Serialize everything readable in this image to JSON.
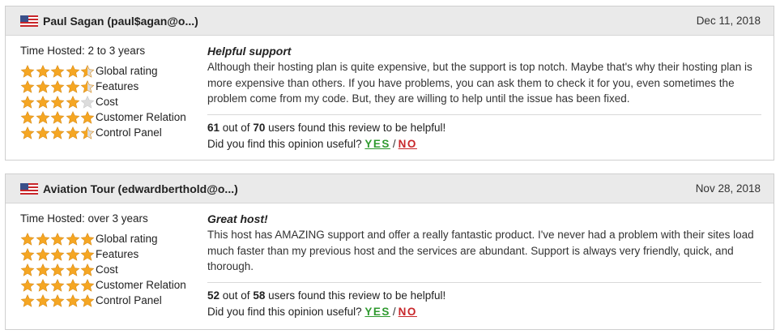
{
  "reviews": [
    {
      "author": "Paul Sagan (paul$agan@o...)",
      "date": "Dec 11, 2018",
      "time_hosted": "Time Hosted: 2 to 3 years",
      "ratings": [
        {
          "label": "Global rating",
          "stars": 4.5
        },
        {
          "label": "Features",
          "stars": 4.5
        },
        {
          "label": "Cost",
          "stars": 4
        },
        {
          "label": "Customer Relation",
          "stars": 5
        },
        {
          "label": "Control Panel",
          "stars": 4.5
        }
      ],
      "title": "Helpful support",
      "text": "Although their hosting plan is quite expensive, but the support is top notch. Maybe that's why their hosting plan is more expensive than others. If you have problems, you can ask them to check it for you, even sometimes the problem come from my code. But, they are willing to help until the issue has been fixed.",
      "helpful_count": "61",
      "helpful_total": "70",
      "out_of_text": " out of ",
      "helpful_suffix": " users found this review to be helpful!",
      "opinion_question": "Did you find this opinion useful?",
      "yes_label": "YES",
      "no_label": "NO"
    },
    {
      "author": "Aviation Tour (edwardberthold@o...)",
      "date": "Nov 28, 2018",
      "time_hosted": "Time Hosted: over 3 years",
      "ratings": [
        {
          "label": "Global rating",
          "stars": 5
        },
        {
          "label": "Features",
          "stars": 5
        },
        {
          "label": "Cost",
          "stars": 5
        },
        {
          "label": "Customer Relation",
          "stars": 5
        },
        {
          "label": "Control Panel",
          "stars": 5
        }
      ],
      "title": "Great host!",
      "text": "This host has AMAZING support and offer a really fantastic product. I've never had a problem with their sites load much faster than my previous host and the services are abundant. Support is always very friendly, quick, and thorough.",
      "helpful_count": "52",
      "helpful_total": "58",
      "out_of_text": " out of ",
      "helpful_suffix": " users found this review to be helpful!",
      "opinion_question": "Did you find this opinion useful?",
      "yes_label": "YES",
      "no_label": "NO"
    }
  ],
  "icons": {
    "flag": "us-flag-icon",
    "star": "star-icon"
  },
  "colors": {
    "star_fill": "#f5a623",
    "star_empty": "#dcdcdc",
    "yes": "#2f9a2f",
    "no": "#c8262a",
    "header_bg": "#eaeaea"
  }
}
